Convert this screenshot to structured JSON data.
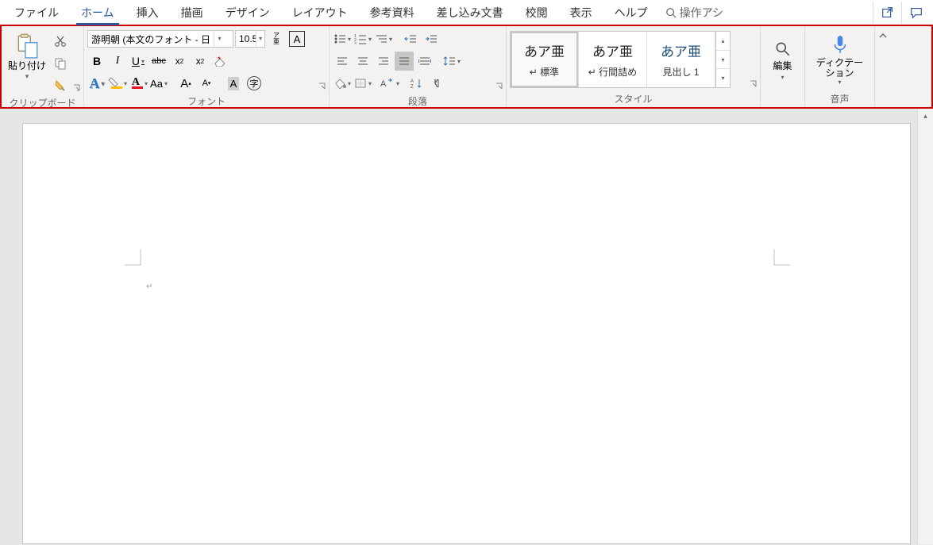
{
  "tabs": {
    "items": [
      "ファイル",
      "ホーム",
      "挿入",
      "描画",
      "デザイン",
      "レイアウト",
      "参考資料",
      "差し込み文書",
      "校閲",
      "表示",
      "ヘルプ"
    ],
    "active": 1,
    "search_placeholder": "操作アシ"
  },
  "ribbon": {
    "clipboard": {
      "paste": "貼り付け",
      "label": "クリップボード"
    },
    "font": {
      "label": "フォント",
      "font_name": "游明朝 (本文のフォント - 日",
      "font_size": "10.5",
      "ruby": "ア\n亜",
      "bold": "B",
      "italic": "I",
      "underline": "U",
      "strike": "abc",
      "sub": "x",
      "sup": "x",
      "big_a": "A",
      "small_a": "A",
      "aa": "Aa",
      "inc": "A",
      "dec": "A",
      "shade": "A",
      "circle": "字"
    },
    "paragraph": {
      "label": "段落"
    },
    "styles": {
      "label": "スタイル",
      "items": [
        {
          "sample": "あア亜",
          "name": "↵ 標準",
          "selected": true
        },
        {
          "sample": "あア亜",
          "name": "↵ 行間詰め",
          "selected": false
        },
        {
          "sample": "あア亜",
          "name": "見出し 1",
          "selected": false
        }
      ]
    },
    "editing": {
      "label": "編集"
    },
    "voice": {
      "label": "音声",
      "btn": "ディクテー\nション"
    }
  },
  "document": {
    "paragraph_mark": "↵"
  }
}
